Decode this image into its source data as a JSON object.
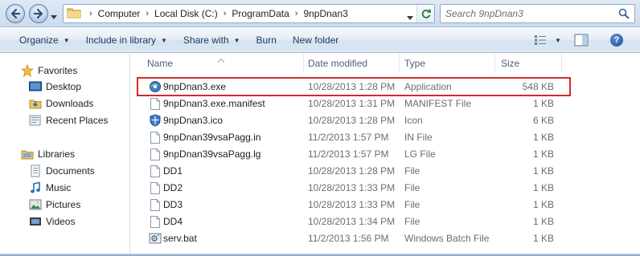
{
  "window": {
    "accent": "#d42a2a"
  },
  "address": {
    "crumbs": [
      "Computer",
      "Local Disk (C:)",
      "ProgramData",
      "9npDnan3"
    ],
    "search_placeholder": "Search 9npDnan3"
  },
  "toolbar": {
    "organize": "Organize",
    "include_in_library": "Include in library",
    "share_with": "Share with",
    "burn": "Burn",
    "new_folder": "New folder"
  },
  "nav": {
    "favorites": "Favorites",
    "desktop": "Desktop",
    "downloads": "Downloads",
    "recent_places": "Recent Places",
    "libraries": "Libraries",
    "documents": "Documents",
    "music": "Music",
    "pictures": "Pictures",
    "videos": "Videos"
  },
  "columns": {
    "name": "Name",
    "date": "Date modified",
    "type": "Type",
    "size": "Size"
  },
  "files": [
    {
      "name": "9npDnan3.exe",
      "date": "10/28/2013 1:28 PM",
      "type": "Application",
      "size": "548 KB",
      "icon": "exe-icon"
    },
    {
      "name": "9npDnan3.exe.manifest",
      "date": "10/28/2013 1:31 PM",
      "type": "MANIFEST File",
      "size": "1 KB",
      "icon": "file-icon"
    },
    {
      "name": "9npDnan3.ico",
      "date": "10/28/2013 1:28 PM",
      "type": "Icon",
      "size": "6 KB",
      "icon": "shield-icon"
    },
    {
      "name": "9npDnan39vsaPagg.in",
      "date": "11/2/2013 1:57 PM",
      "type": "IN File",
      "size": "1 KB",
      "icon": "file-icon"
    },
    {
      "name": "9npDnan39vsaPagg.lg",
      "date": "11/2/2013 1:57 PM",
      "type": "LG File",
      "size": "1 KB",
      "icon": "file-icon"
    },
    {
      "name": "DD1",
      "date": "10/28/2013 1:28 PM",
      "type": "File",
      "size": "1 KB",
      "icon": "file-icon"
    },
    {
      "name": "DD2",
      "date": "10/28/2013 1:33 PM",
      "type": "File",
      "size": "1 KB",
      "icon": "file-icon"
    },
    {
      "name": "DD3",
      "date": "10/28/2013 1:33 PM",
      "type": "File",
      "size": "1 KB",
      "icon": "file-icon"
    },
    {
      "name": "DD4",
      "date": "10/28/2013 1:34 PM",
      "type": "File",
      "size": "1 KB",
      "icon": "file-icon"
    },
    {
      "name": "serv.bat",
      "date": "11/2/2013 1:56 PM",
      "type": "Windows Batch File",
      "size": "1 KB",
      "icon": "batch-file-icon"
    }
  ]
}
